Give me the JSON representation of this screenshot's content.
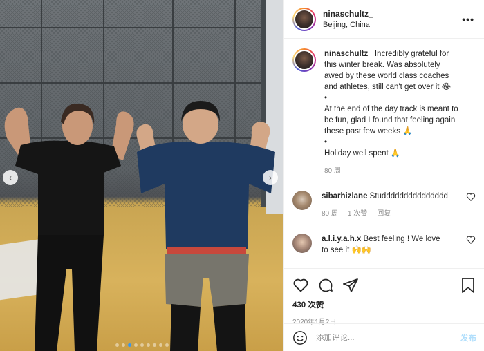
{
  "post": {
    "author": "ninaschultz_",
    "location": "Beijing, China",
    "more_label": "•••"
  },
  "caption": {
    "username": "ninaschultz_",
    "lines": [
      "Incredibly grateful for",
      "this winter break. Was absolutely",
      "awed by these world class coaches",
      "and athletes, still can't get over it 😂",
      "•",
      "At the end of the day track is meant to",
      "be fun, glad I found that feeling again",
      "these past few weeks 🙏",
      "•",
      "Holiday well spent 🙏"
    ],
    "time": "80 周"
  },
  "comments": [
    {
      "username": "sibarhizlane",
      "text": "Studdddddddddddddd",
      "time": "80 周",
      "likes": "1 次赞",
      "reply": "回复"
    },
    {
      "username": "a.l.i.y.a.h.x",
      "text": "Best feeling ! We love",
      "text2": "to see it 🙌🙌"
    }
  ],
  "engagement": {
    "likes": "430 次赞",
    "date": "2020年1月2日"
  },
  "composer": {
    "placeholder": "添加评论...",
    "post_label": "发布"
  },
  "carousel": {
    "prev": "‹",
    "next": "›",
    "count": 9,
    "active_index": 2
  },
  "colors": {
    "accent": "#3797f0",
    "post_button": "#b2dffc",
    "muted": "#8e8e8e"
  }
}
